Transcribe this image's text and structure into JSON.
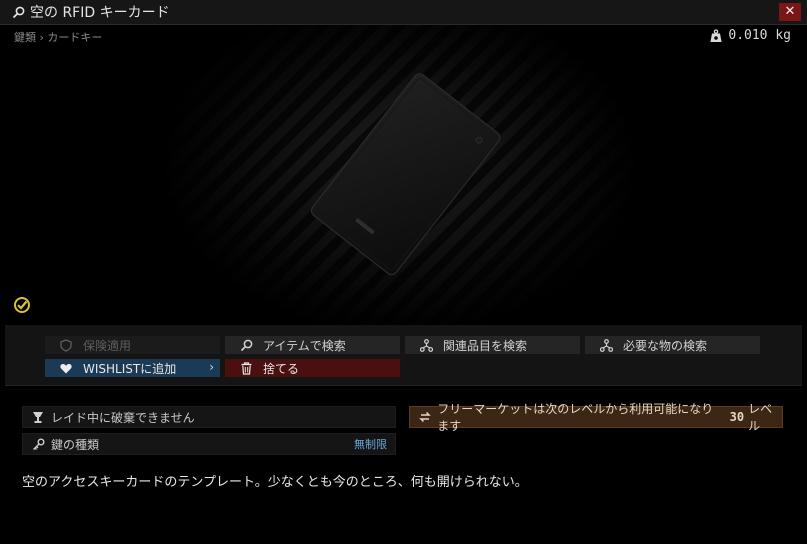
{
  "window": {
    "title": "空の RFID キーカード",
    "close_label": "✕"
  },
  "breadcrumb": {
    "category": "鍵類",
    "separator": "›",
    "subcategory": "カードキー"
  },
  "weight": {
    "value": "0.010 kg"
  },
  "actions": {
    "insurance": "保険適用",
    "search_item": "アイテムで検索",
    "search_related": "関連品目を検索",
    "search_required": "必要な物の検索",
    "wishlist": "WISHLISTに追加",
    "wishlist_chevron": "›",
    "discard": "捨てる"
  },
  "info": {
    "raid_note": "レイド中に破棄できません",
    "key_type_label": "鍵の種類",
    "key_type_value": "無制限",
    "flea_text": "フリーマーケットは次のレベルから利用可能になります",
    "flea_level": "30",
    "flea_level_unit": "レベル"
  },
  "description": "空のアクセスキーカードのテンプレート。少なくとも今のところ、何も開けられない。",
  "icons": {
    "title": "magnifier-icon",
    "weight": "weight-icon",
    "examined": "check-circle-icon",
    "insurance": "shield-icon",
    "search_item": "magnifier-icon",
    "search_related": "network-icon",
    "search_required": "network-icon",
    "wishlist": "heart-icon",
    "discard": "trash-icon",
    "raid": "no-discard-icon",
    "key": "key-icon",
    "flea": "swap-icon"
  },
  "colors": {
    "accent_blue": "#1b3a55",
    "danger_red": "#4a0f0f",
    "flea_bg": "#3b2714",
    "check_yellow": "#d8c23a"
  }
}
